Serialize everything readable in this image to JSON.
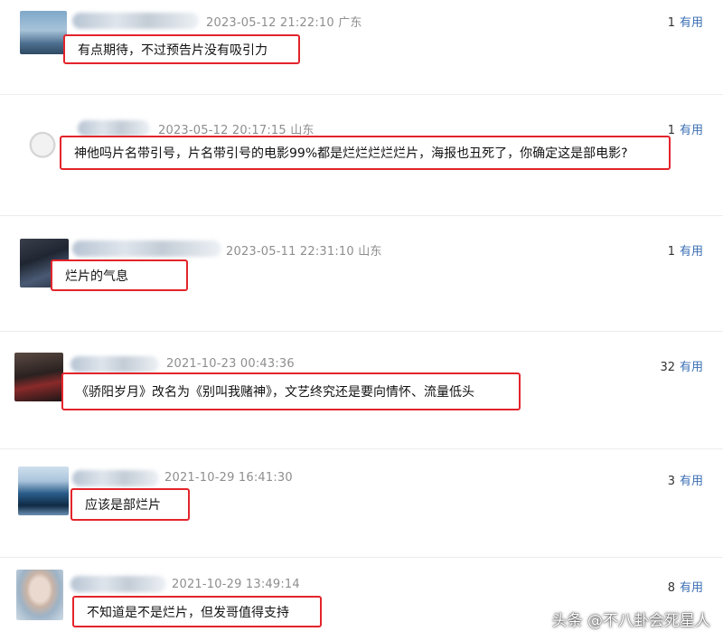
{
  "comments": [
    {
      "meta": "2023-05-12 21:22:10 广东",
      "useful_count": "1",
      "useful_label": "有用",
      "text": "有点期待，不过预告片没有吸引力"
    },
    {
      "meta": "2023-05-12 20:17:15 山东",
      "useful_count": "1",
      "useful_label": "有用",
      "text": "神他吗片名带引号，片名带引号的电影99%都是烂烂烂烂烂片，海报也丑死了，你确定这是部电影?"
    },
    {
      "meta": "2023-05-11 22:31:10 山东",
      "useful_count": "1",
      "useful_label": "有用",
      "text": "烂片的气息"
    },
    {
      "meta": "2021-10-23 00:43:36",
      "useful_count": "32",
      "useful_label": "有用",
      "text": "《骄阳岁月》改名为《别叫我赌神》，文艺终究还是要向情怀、流量低头"
    },
    {
      "meta": "2021-10-29 16:41:30",
      "useful_count": "3",
      "useful_label": "有用",
      "text": "应该是部烂片"
    },
    {
      "meta": "2021-10-29 13:49:14",
      "useful_count": "8",
      "useful_label": "有用",
      "text": "不知道是不是烂片，但发哥值得支持"
    }
  ],
  "watermark": "头条 @不八卦会死星人",
  "colors": {
    "highlight": "#e3242b",
    "link": "#3b6fb4",
    "meta": "#8e8e8e"
  }
}
